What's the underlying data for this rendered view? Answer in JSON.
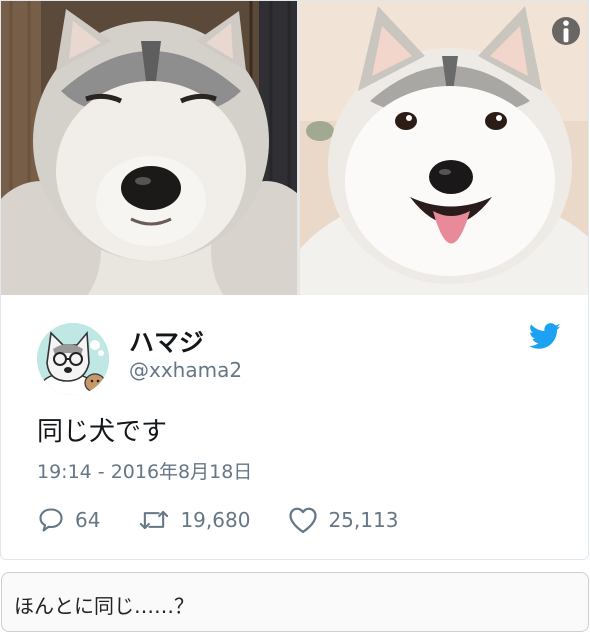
{
  "tweet": {
    "display_name": "ハマジ",
    "screen_name": "@xxhama2",
    "text": "同じ犬です",
    "timestamp": "19:14 - 2016年8月18日",
    "stats": {
      "replies": "64",
      "retweets": "19,680",
      "likes": "25,113"
    }
  },
  "icons": {
    "info": "info-icon",
    "bird": "twitter-bird-icon",
    "reply": "reply-icon",
    "retweet": "retweet-icon",
    "like": "heart-icon"
  },
  "colors": {
    "twitter_blue": "#1da1f2",
    "secondary_text": "#657786",
    "primary_text": "#14171a"
  },
  "comment": {
    "text": "ほんとに同じ……？"
  }
}
